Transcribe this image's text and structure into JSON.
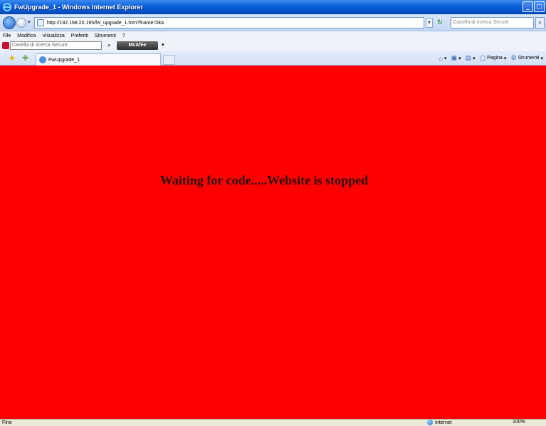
{
  "window": {
    "title": "FwUpgrade_1 - Windows Internet Explorer"
  },
  "address_bar": {
    "url": "http://192.168.20.195/fw_upgrade_1.htm?fname=lika",
    "search_placeholder": "Casella di ricerca Secure"
  },
  "menu": [
    "File",
    "Modifica",
    "Visualizza",
    "Preferiti",
    "Strumenti",
    "?"
  ],
  "mcafee": {
    "search_placeholder": "Casella di ricerca Secure",
    "brand": "McAfee"
  },
  "tabs": [
    {
      "label": "FwUpgrade_1"
    }
  ],
  "command_bar": {
    "page_label": "Pagina",
    "tools_label": "Strumenti"
  },
  "page": {
    "message": "Waiting for code.....Website is stopped",
    "background": "#ff0000"
  },
  "status": {
    "text": "Fine",
    "zone": "Internet",
    "zoom": "100%"
  }
}
